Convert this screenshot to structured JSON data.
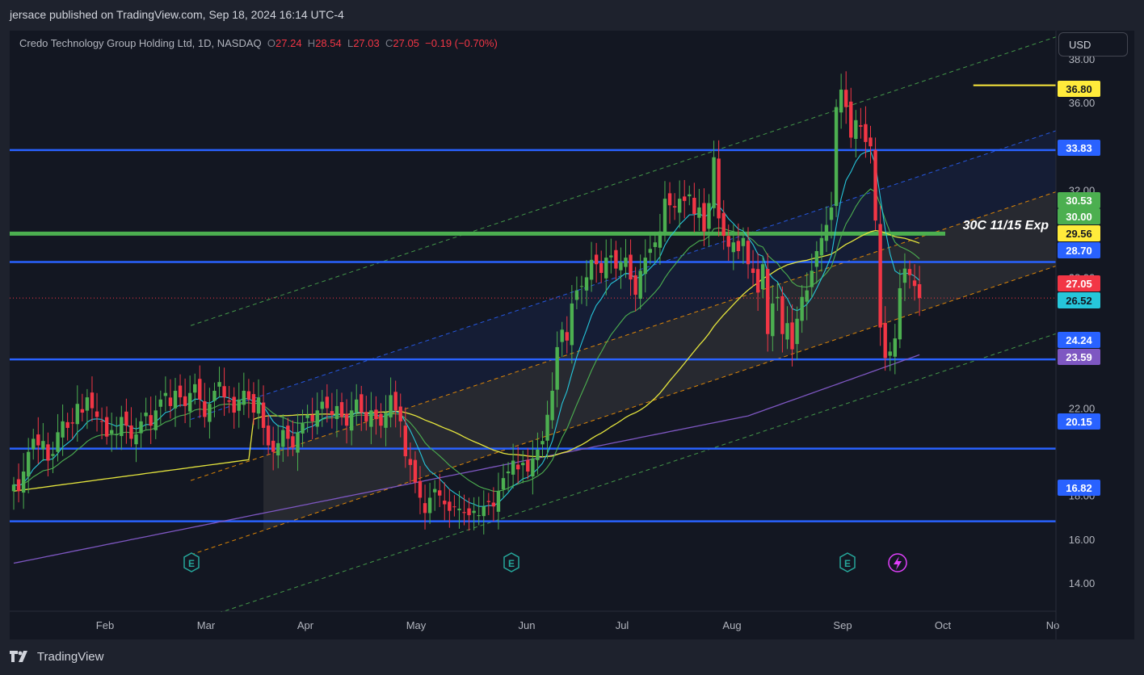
{
  "publisher_line": "jersace published on TradingView.com, Sep 18, 2024 16:14 UTC-4",
  "legend": {
    "symbol": "Credo Technology Group Holding Ltd, 1D, NASDAQ",
    "o_label": "O",
    "o": "27.24",
    "h_label": "H",
    "h": "28.54",
    "l_label": "L",
    "l": "27.03",
    "c_label": "C",
    "c": "27.05",
    "change": "−0.19 (−0.70%)"
  },
  "currency_button": "USD",
  "annotation": "30C 11/15 Exp",
  "footer_brand": "TradingView",
  "colors": {
    "background": "#131722",
    "up": "#26a69a",
    "up_candle": "#4caf50",
    "down": "#f23645",
    "hline": "#2962ff",
    "green_line": "#4caf50",
    "resistance_yellow": "#ffeb3b",
    "ma_yellow": "#e5e53d",
    "ma_purple": "#7e57c2",
    "ma_cyan": "#26c6da",
    "ma_green": "#4caf50"
  },
  "chart_data": {
    "type": "candlestick",
    "y_axis": {
      "ticks": [
        "38.00",
        "36.00",
        "32.00",
        "28.00",
        "22.00",
        "18.00",
        "16.00",
        "14.00"
      ],
      "tick_values": [
        38,
        36,
        32,
        28,
        22,
        18,
        16,
        14
      ],
      "range": [
        12.7,
        39.3
      ]
    },
    "x_axis": {
      "ticks": [
        "Feb",
        "Mar",
        "Apr",
        "May",
        "Jun",
        "Jul",
        "Aug",
        "Sep",
        "Oct",
        "No"
      ]
    },
    "price_tags": [
      {
        "label": "36.80",
        "value": 36.8,
        "bg": "#ffeb3b",
        "fg": "#131722"
      },
      {
        "label": "33.83",
        "value": 33.83,
        "bg": "#2962ff",
        "fg": "#ffffff"
      },
      {
        "label": "30.53",
        "value": 30.53,
        "bg": "#4caf50",
        "fg": "#ffffff"
      },
      {
        "label": "30.00",
        "value": 30.0,
        "bg": "#4caf50",
        "fg": "#ffffff"
      },
      {
        "label": "29.56",
        "value": 29.56,
        "bg": "#ffeb3b",
        "fg": "#131722"
      },
      {
        "label": "28.70",
        "value": 28.7,
        "bg": "#2962ff",
        "fg": "#ffffff"
      },
      {
        "label": "27.05",
        "value": 27.05,
        "bg": "#f23645",
        "fg": "#ffffff"
      },
      {
        "label": "26.52",
        "value": 26.52,
        "bg": "#26c6da",
        "fg": "#131722"
      },
      {
        "label": "24.24",
        "value": 24.24,
        "bg": "#2962ff",
        "fg": "#ffffff"
      },
      {
        "label": "23.59",
        "value": 23.59,
        "bg": "#7e57c2",
        "fg": "#ffffff"
      },
      {
        "label": "20.15",
        "value": 20.15,
        "bg": "#2962ff",
        "fg": "#ffffff"
      },
      {
        "label": "16.82",
        "value": 16.82,
        "bg": "#2962ff",
        "fg": "#ffffff"
      }
    ],
    "horizontal_levels": [
      33.83,
      28.7,
      24.24,
      20.15,
      16.82
    ],
    "green_level": 30.0,
    "resistance_level": 36.8,
    "earnings_marks": [
      {
        "month": "Mar"
      },
      {
        "month": "Jun"
      },
      {
        "month": "Sep"
      }
    ],
    "closes": [
      18.5,
      18.2,
      19.1,
      20.0,
      20.6,
      20.3,
      20.5,
      19.6,
      19.9,
      20.9,
      21.4,
      21.1,
      21.3,
      22.2,
      21.8,
      22.5,
      22.0,
      21.6,
      21.4,
      20.7,
      21.0,
      20.8,
      21.6,
      21.2,
      20.6,
      20.8,
      21.4,
      21.8,
      21.2,
      21.9,
      22.4,
      22.7,
      22.1,
      22.8,
      22.5,
      22.1,
      22.7,
      23.1,
      22.4,
      21.6,
      22.2,
      22.8,
      23.2,
      22.5,
      22.3,
      21.8,
      22.4,
      22.8,
      22.4,
      21.8,
      22.5,
      21.1,
      20.3,
      20.0,
      20.4,
      21.0,
      20.6,
      20.2,
      20.9,
      21.3,
      21.7,
      21.4,
      21.9,
      22.3,
      22.0,
      21.7,
      22.1,
      21.6,
      21.2,
      21.9,
      22.4,
      21.8,
      21.4,
      21.9,
      21.5,
      21.2,
      21.8,
      22.6,
      21.9,
      21.4,
      19.8,
      19.4,
      18.6,
      17.9,
      17.2,
      17.9,
      18.3,
      18.0,
      17.6,
      17.3,
      17.5,
      17.4,
      17.2,
      17.1,
      17.3,
      17.1,
      17.5,
      17.7,
      17.5,
      18.2,
      18.8,
      19.1,
      19.6,
      19.2,
      19.5,
      19.1,
      19.7,
      20.1,
      20.5,
      21.7,
      22.8,
      24.8,
      25.6,
      25.1,
      26.8,
      27.4,
      27.6,
      28.0,
      28.8,
      28.6,
      28.2,
      28.9,
      29.0,
      28.4,
      28.7,
      28.9,
      27.9,
      27.2,
      28.3,
      28.9,
      29.3,
      29.6,
      30.1,
      31.6,
      31.3,
      31.2,
      31.6,
      31.5,
      31.8,
      30.9,
      31.2,
      30.1,
      31.4,
      33.5,
      30.7,
      29.9,
      29.4,
      29.6,
      29.2,
      29.8,
      28.6,
      28.2,
      27.3,
      28.6,
      25.4,
      26.8,
      27.1,
      25.4,
      25.9,
      24.7,
      26.1,
      27.1,
      27.4,
      28.3,
      29.2,
      29.8,
      30.4,
      31.2,
      35.8,
      36.6,
      35.8,
      34.4,
      35.2,
      34.9,
      34.2,
      34.0,
      30.6,
      25.7,
      24.3,
      24.6,
      25.2,
      27.5,
      28.4,
      28.1,
      27.6,
      27.05
    ]
  }
}
